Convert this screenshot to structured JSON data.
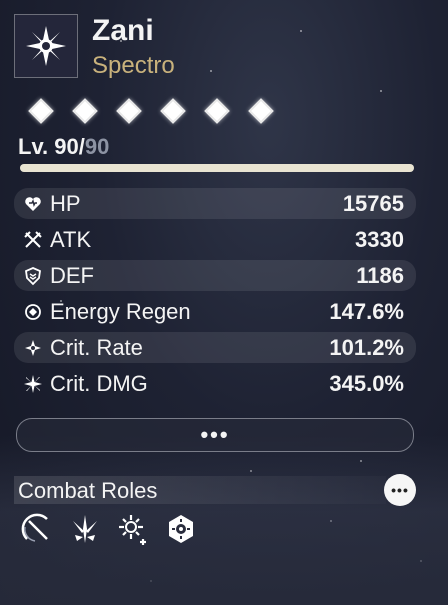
{
  "character": {
    "name": "Zani",
    "element": "Spectro",
    "element_icon": "spectro-sun-icon"
  },
  "resonance_chain": {
    "nodes": 6,
    "unlocked": 6
  },
  "level": {
    "prefix": "Lv. ",
    "current": "90",
    "separator": "/",
    "max": "90",
    "progress": 1.0
  },
  "stats": [
    {
      "icon": "hp-heart-icon",
      "label": "HP",
      "value": "15765"
    },
    {
      "icon": "atk-swords-icon",
      "label": "ATK",
      "value": "3330"
    },
    {
      "icon": "def-shield-icon",
      "label": "DEF",
      "value": "1186"
    },
    {
      "icon": "energy-regen-icon",
      "label": "Energy Regen",
      "value": "147.6%"
    },
    {
      "icon": "crit-rate-icon",
      "label": "Crit. Rate",
      "value": "101.2%"
    },
    {
      "icon": "crit-dmg-icon",
      "label": "Crit. DMG",
      "value": "345.0%"
    }
  ],
  "more_button": "•••",
  "combat_roles": {
    "title": "Combat Roles",
    "more": "•••",
    "icons": [
      "role-crescent-blade-icon",
      "role-burst-icon",
      "role-buff-plus-icon",
      "role-hexagon-sun-icon"
    ]
  },
  "colors": {
    "element_text": "#c9b27c",
    "level_max": "#8d93a3",
    "accent": "#e9e4d2"
  }
}
